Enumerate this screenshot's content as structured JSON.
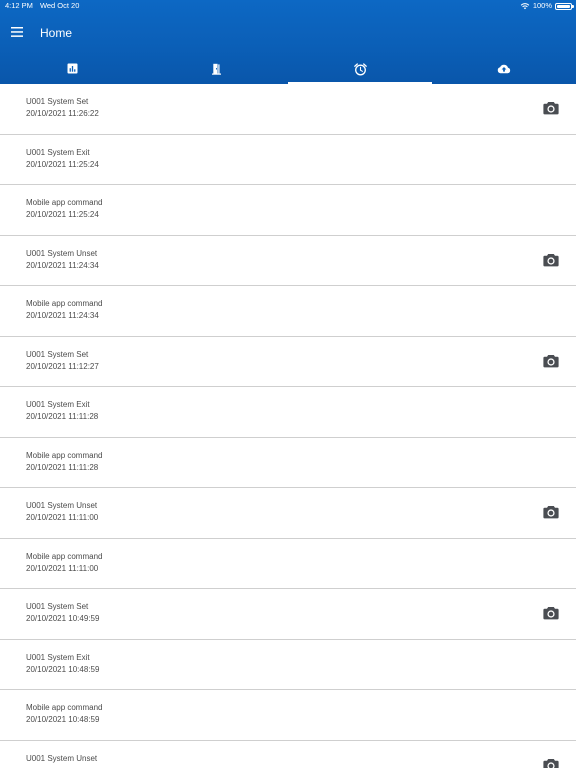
{
  "status_bar": {
    "time": "4:12 PM",
    "date": "Wed Oct 20",
    "battery_text": "100%",
    "battery_level": 1.0
  },
  "appbar": {
    "title": "Home",
    "menu_icon": "menu-icon"
  },
  "tabs": [
    {
      "icon": "bar-chart-icon",
      "active": false
    },
    {
      "icon": "door-exit-icon",
      "active": false
    },
    {
      "icon": "alarm-clock-icon",
      "active": true
    },
    {
      "icon": "cloud-upload-icon",
      "active": false
    }
  ],
  "events": [
    {
      "title": "U001 System Set",
      "timestamp": "20/10/2021 11:26:22",
      "has_camera": true
    },
    {
      "title": "U001 System Exit",
      "timestamp": "20/10/2021 11:25:24",
      "has_camera": false
    },
    {
      "title": "Mobile app command",
      "timestamp": "20/10/2021 11:25:24",
      "has_camera": false
    },
    {
      "title": "U001 System Unset",
      "timestamp": "20/10/2021 11:24:34",
      "has_camera": true
    },
    {
      "title": "Mobile app command",
      "timestamp": "20/10/2021 11:24:34",
      "has_camera": false
    },
    {
      "title": "U001 System Set",
      "timestamp": "20/10/2021 11:12:27",
      "has_camera": true
    },
    {
      "title": "U001 System Exit",
      "timestamp": "20/10/2021 11:11:28",
      "has_camera": false
    },
    {
      "title": "Mobile app command",
      "timestamp": "20/10/2021 11:11:28",
      "has_camera": false
    },
    {
      "title": "U001 System Unset",
      "timestamp": "20/10/2021 11:11:00",
      "has_camera": true
    },
    {
      "title": "Mobile app command",
      "timestamp": "20/10/2021 11:11:00",
      "has_camera": false
    },
    {
      "title": "U001 System Set",
      "timestamp": "20/10/2021 10:49:59",
      "has_camera": true
    },
    {
      "title": "U001 System Exit",
      "timestamp": "20/10/2021 10:48:59",
      "has_camera": false
    },
    {
      "title": "Mobile app command",
      "timestamp": "20/10/2021 10:48:59",
      "has_camera": false
    },
    {
      "title": "U001 System Unset",
      "timestamp": "",
      "has_camera": true
    }
  ],
  "colors": {
    "header_primary": "#0b5fb7",
    "text": "#4b4b4b",
    "divider": "#cfcfcf",
    "camera_icon": "#4a4d52"
  }
}
